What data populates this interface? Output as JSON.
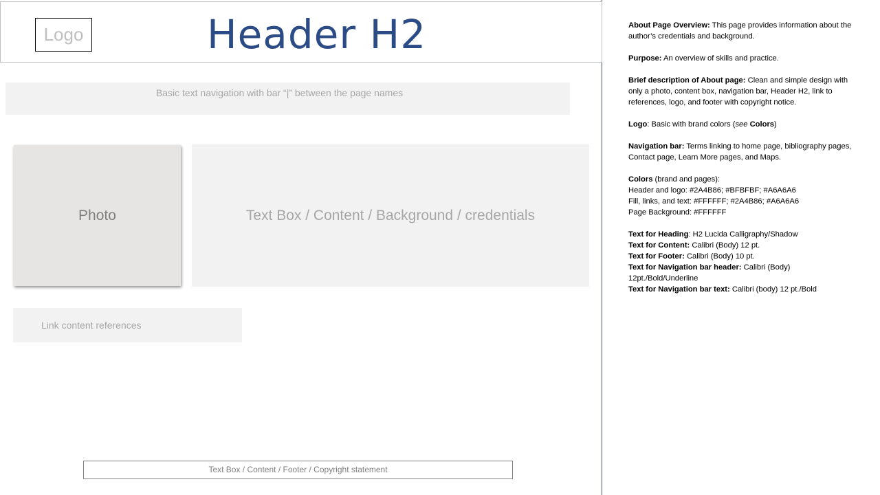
{
  "header": {
    "logo_label": "Logo",
    "title": "Header H2"
  },
  "nav": {
    "text": "Basic text navigation with  bar “|” between the page names"
  },
  "photo": {
    "label": "Photo"
  },
  "content": {
    "label": "Text Box / Content / Background / credentials"
  },
  "references": {
    "label": "Link content references"
  },
  "footer": {
    "label": "Text Box / Content  / Footer / Copyright statement"
  },
  "notes": {
    "overview": {
      "label": "About Page Overview:",
      "text": " This page provides information about the author’s credentials and background."
    },
    "purpose": {
      "label": "Purpose:",
      "text": " An overview of skills and practice."
    },
    "description": {
      "label": "Brief description of About page:",
      "text": " Clean and simple design with only a photo, content box, navigation bar, Header H2, link to references,  logo, and footer with copyright notice."
    },
    "logo": {
      "label": "Logo",
      "text_a": ": Basic with brand colors (",
      "see": "see",
      "colors_word": " Colors",
      "text_b": ")"
    },
    "navbar": {
      "label": "Navigation bar:",
      "text": " Terms linking to home page, bibliography pages, Contact page, Learn More pages, and Maps."
    },
    "colors": {
      "label": "Colors",
      "text": " (brand and pages):",
      "line1": "Header and logo: #2A4B86; #BFBFBF;  #A6A6A6",
      "line2": "Fill, links, and text: #FFFFFF; #2A4B86; #A6A6A6",
      "line3": "Page Background:  #FFFFFF"
    },
    "text_specs": [
      {
        "label": "Text for Heading",
        "text": ":  H2 Lucida Calligraphy/Shadow"
      },
      {
        "label": "Text for Content:",
        "text": " Calibri (Body) 12 pt."
      },
      {
        "label": "Text for Footer:",
        "text": " Calibri (Body) 10 pt."
      },
      {
        "label": "Text for Navigation bar header:",
        "text": " Calibri (Body) 12pt./Bold/Underline"
      },
      {
        "label": "Text for Navigation bar text:",
        "text": " Calibri (body) 12 pt./Bold"
      }
    ]
  },
  "colors": {
    "brand_blue": "#2A4B86",
    "light_gray": "#BFBFBF",
    "mid_gray": "#A6A6A6",
    "fill_gray": "#F2F2F2",
    "photo_gray": "#E7E4E4"
  }
}
